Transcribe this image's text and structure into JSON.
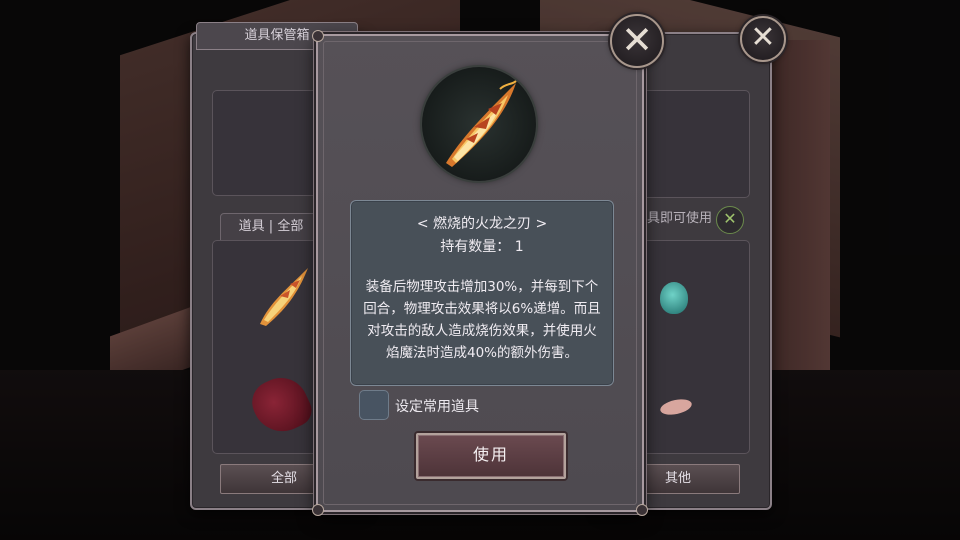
{
  "background_panel": {
    "title": "道具保管箱",
    "tab_label": "道具 | 全部",
    "right_note": "道具即可使用",
    "small_close": "✕",
    "filter_all": "全部",
    "filter_other": "其他"
  },
  "popup": {
    "item_name": "< 燃烧的火龙之刃 >",
    "count_label": "持有数量：  1",
    "description": "装备后物理攻击增加30%，并每到下个回合，物理攻击效果将以6%递增。而且对攻击的敌人造成烧伤效果，并使用火焰魔法时造成40%的额外伤害。",
    "favorite_checkbox_label": "设定常用道具",
    "favorite_checked": false,
    "use_button": "使用"
  },
  "icons": {
    "close_main": "close-icon",
    "close_back": "close-icon",
    "item": "flame-dragon-blade-icon"
  },
  "close_glyph": "✕",
  "colors": {
    "panel_bg": "#4e4a50",
    "desc_box_bg": "#485058",
    "use_button_bg": "#5c3e44"
  }
}
